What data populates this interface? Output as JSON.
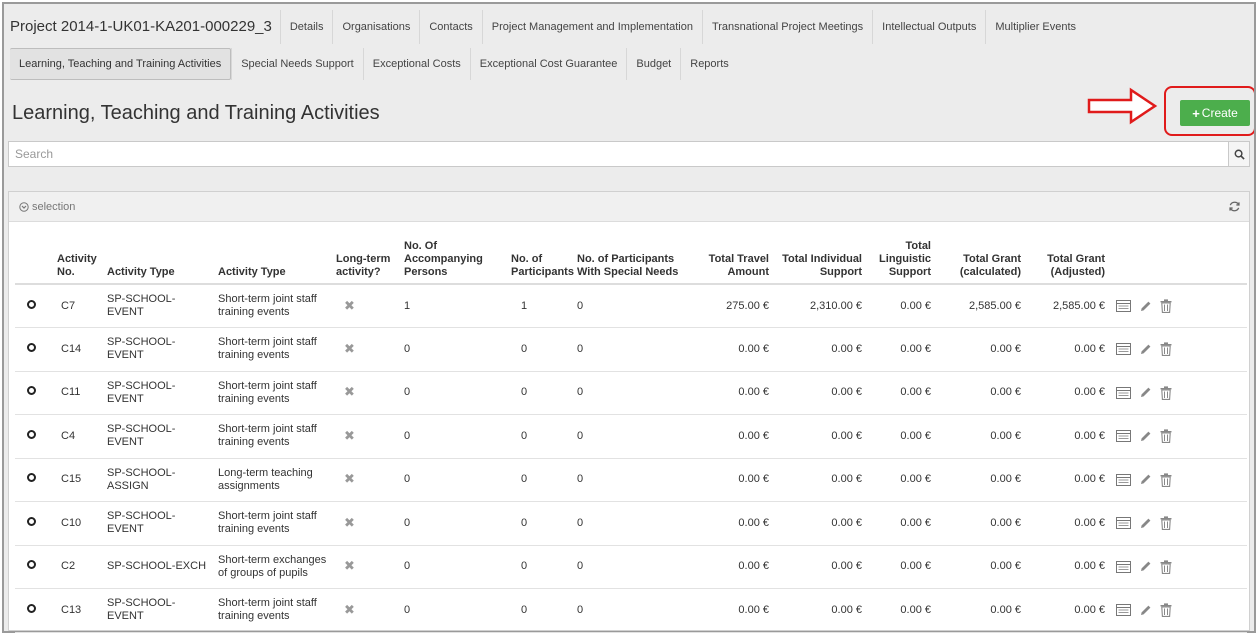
{
  "project_title": "Project 2014-1-UK01-KA201-000229_3",
  "tabs_row1": [
    "Details",
    "Organisations",
    "Contacts",
    "Project Management and Implementation",
    "Transnational Project Meetings",
    "Intellectual Outputs",
    "Multiplier Events"
  ],
  "tabs_row2": [
    "Learning, Teaching and Training Activities",
    "Special Needs Support",
    "Exceptional Costs",
    "Exceptional Cost Guarantee",
    "Budget",
    "Reports"
  ],
  "page_title": "Learning, Teaching and Training Activities",
  "create_label": "Create",
  "search_placeholder": "Search",
  "selection_label": "selection",
  "colors": {
    "create_green": "#4cae4c",
    "highlight_red": "#e01b1b"
  },
  "columns": {
    "activity_no": "Activity No.",
    "activity_type_code": "Activity Type",
    "activity_type": "Activity Type",
    "long_term": "Long-term activity?",
    "accompanying": "No. Of Accompanying Persons",
    "participants": "No. of Participants",
    "special_needs": "No. of Participants With Special Needs",
    "travel": "Total Travel Amount",
    "individual": "Total Individual Support",
    "linguistic": "Total Linguistic Support",
    "grant_calc": "Total Grant (calculated)",
    "grant_adj": "Total Grant (Adjusted)"
  },
  "rows": [
    {
      "no": "C7",
      "code": "SP-SCHOOL-EVENT",
      "type": "Short-term joint staff training events",
      "acc": "1",
      "part": "1",
      "sn": "0",
      "travel": "275.00 €",
      "indiv": "2,310.00 €",
      "ling": "0.00 €",
      "calc": "2,585.00 €",
      "adj": "2,585.00 €"
    },
    {
      "no": "C14",
      "code": "SP-SCHOOL-EVENT",
      "type": "Short-term joint staff training events",
      "acc": "0",
      "part": "0",
      "sn": "0",
      "travel": "0.00 €",
      "indiv": "0.00 €",
      "ling": "0.00 €",
      "calc": "0.00 €",
      "adj": "0.00 €"
    },
    {
      "no": "C11",
      "code": "SP-SCHOOL-EVENT",
      "type": "Short-term joint staff training events",
      "acc": "0",
      "part": "0",
      "sn": "0",
      "travel": "0.00 €",
      "indiv": "0.00 €",
      "ling": "0.00 €",
      "calc": "0.00 €",
      "adj": "0.00 €"
    },
    {
      "no": "C4",
      "code": "SP-SCHOOL-EVENT",
      "type": "Short-term joint staff training events",
      "acc": "0",
      "part": "0",
      "sn": "0",
      "travel": "0.00 €",
      "indiv": "0.00 €",
      "ling": "0.00 €",
      "calc": "0.00 €",
      "adj": "0.00 €"
    },
    {
      "no": "C15",
      "code": "SP-SCHOOL-ASSIGN",
      "type": "Long-term teaching assignments",
      "acc": "0",
      "part": "0",
      "sn": "0",
      "travel": "0.00 €",
      "indiv": "0.00 €",
      "ling": "0.00 €",
      "calc": "0.00 €",
      "adj": "0.00 €"
    },
    {
      "no": "C10",
      "code": "SP-SCHOOL-EVENT",
      "type": "Short-term joint staff training events",
      "acc": "0",
      "part": "0",
      "sn": "0",
      "travel": "0.00 €",
      "indiv": "0.00 €",
      "ling": "0.00 €",
      "calc": "0.00 €",
      "adj": "0.00 €"
    },
    {
      "no": "C2",
      "code": "SP-SCHOOL-EXCH",
      "type": "Short-term exchanges of groups of pupils",
      "acc": "0",
      "part": "0",
      "sn": "0",
      "travel": "0.00 €",
      "indiv": "0.00 €",
      "ling": "0.00 €",
      "calc": "0.00 €",
      "adj": "0.00 €"
    },
    {
      "no": "C13",
      "code": "SP-SCHOOL-EVENT",
      "type": "Short-term joint staff training events",
      "acc": "0",
      "part": "0",
      "sn": "0",
      "travel": "0.00 €",
      "indiv": "0.00 €",
      "ling": "0.00 €",
      "calc": "0.00 €",
      "adj": "0.00 €"
    }
  ]
}
